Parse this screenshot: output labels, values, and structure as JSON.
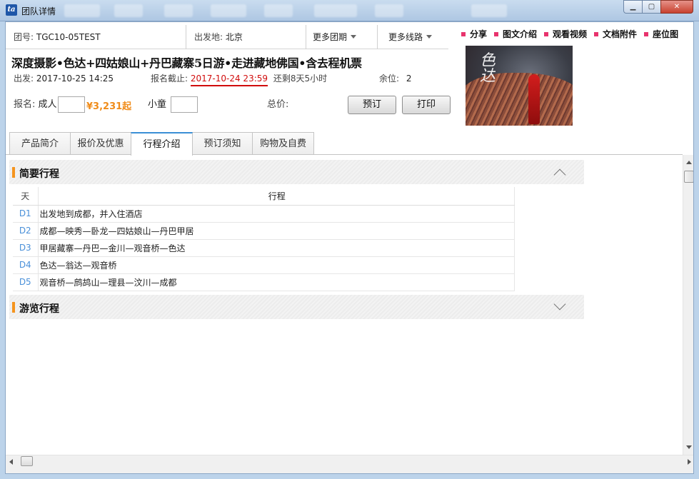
{
  "window": {
    "title": "团队详情",
    "controls": {
      "minimize": "▁",
      "maximize": "▢",
      "close": "✕"
    }
  },
  "header": {
    "group_no_label": "团号:",
    "group_no": "TGC10-05TEST",
    "depart_city_label": "出发地:",
    "depart_city": "北京",
    "more_groups": "更多团期",
    "more_routes": "更多线路",
    "title": "深度摄影•色达+四姑娘山+丹巴藏寨5日游•走进藏地佛国•含去程机票",
    "depart_label": "出发:",
    "depart_time": "2017-10-25 14:25",
    "deadline_label": "报名截止:",
    "deadline": "2017-10-24 23:59",
    "remaining": "还剩8天5小时",
    "seats_label": "余位:",
    "seats": "2"
  },
  "booking": {
    "signup_label": "报名:",
    "adult_label": "成人",
    "adult_value": "",
    "price": "¥3,231起",
    "child_label": "小童",
    "child_value": "",
    "total_label": "总价:",
    "book_button": "预订",
    "print_button": "打印"
  },
  "links": [
    "分享",
    "图文介绍",
    "观看视频",
    "文档附件",
    "座位图"
  ],
  "tabs": [
    "产品简介",
    "报价及优惠",
    "行程介绍",
    "预订须知",
    "购物及自费"
  ],
  "active_tab": "行程介绍",
  "brief_itinerary": {
    "title": "简要行程",
    "col_day": "天",
    "col_route": "行程",
    "rows": [
      {
        "day": "D1",
        "route": "出发地到成都，并入住酒店"
      },
      {
        "day": "D2",
        "route": "成都—映秀—卧龙—四姑娘山—丹巴甲居"
      },
      {
        "day": "D3",
        "route": "甲居藏寨—丹巴—金川—观音桥—色达"
      },
      {
        "day": "D4",
        "route": "色达—翁达—观音桥"
      },
      {
        "day": "D5",
        "route": "观音桥—鹧鸪山—理县—汶川—成都"
      }
    ]
  },
  "tour_itinerary": {
    "title": "游览行程"
  },
  "colors": {
    "accent": "#f5941e",
    "link_dot": "#e8336d",
    "deadline": "#d10c0c",
    "price": "#f08c1a",
    "tab_active": "#3a8fd6"
  }
}
